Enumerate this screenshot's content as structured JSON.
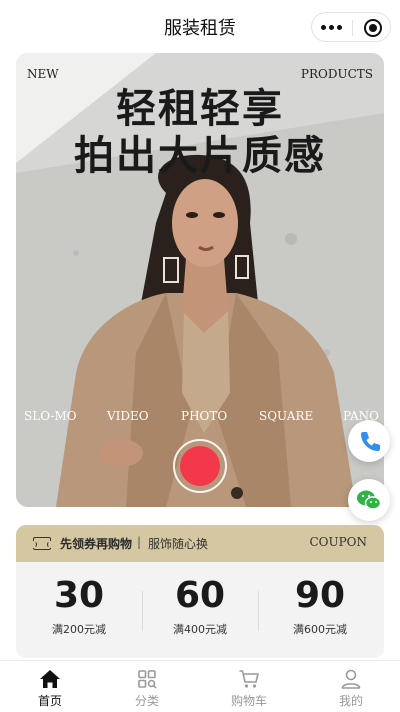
{
  "header": {
    "title": "服装租赁"
  },
  "hero": {
    "corner_left": "NEW",
    "corner_right": "PRODUCTS",
    "title_line1": "轻租轻享",
    "title_line2": "拍出大片质感",
    "modes": [
      "SLO-MO",
      "VIDEO",
      "PHOTO",
      "SQUARE",
      "PANO"
    ]
  },
  "coupon": {
    "headline": "先领券再购物",
    "separator": "|",
    "subline": "服饰随心换",
    "tag": "COUPON",
    "items": [
      {
        "amount": "30",
        "condition": "满200元减"
      },
      {
        "amount": "60",
        "condition": "满400元减"
      },
      {
        "amount": "90",
        "condition": "满600元减"
      }
    ]
  },
  "tabbar": {
    "items": [
      {
        "label": "首页",
        "icon": "home-icon",
        "active": true
      },
      {
        "label": "分类",
        "icon": "grid-icon",
        "active": false
      },
      {
        "label": "购物车",
        "icon": "cart-icon",
        "active": false
      },
      {
        "label": "我的",
        "icon": "user-icon",
        "active": false
      }
    ]
  },
  "colors": {
    "shutter_red": "#f4384b",
    "coupon_gold": "#d4c7a2",
    "phone_blue": "#2e8ff0",
    "wechat_green": "#2cb544"
  }
}
